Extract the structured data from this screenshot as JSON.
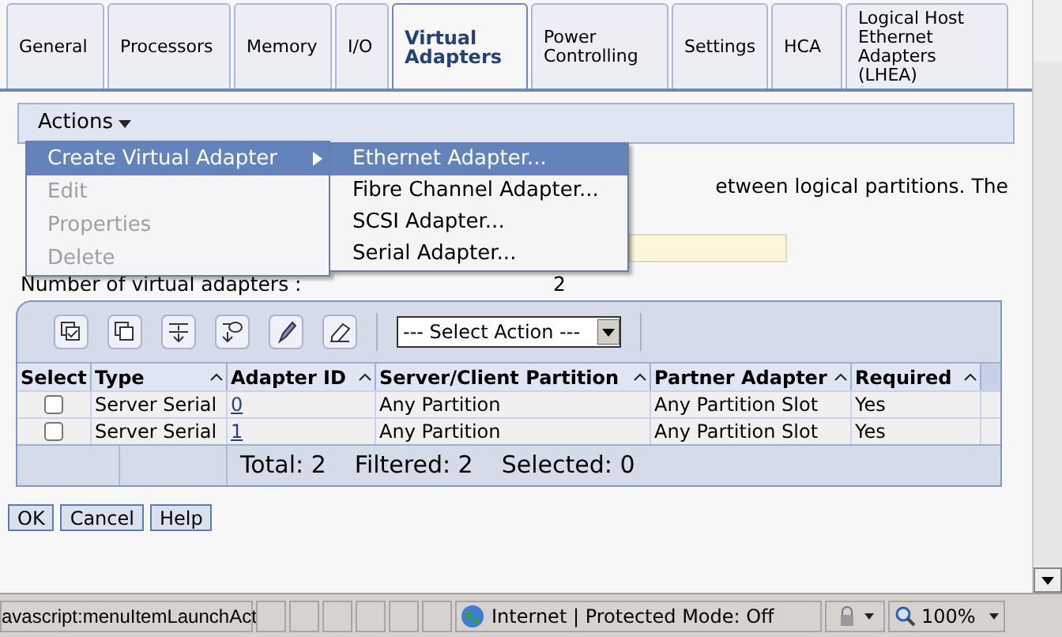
{
  "tabs": [
    {
      "label": "General",
      "selected": false
    },
    {
      "label": "Processors",
      "selected": false
    },
    {
      "label": "Memory",
      "selected": false
    },
    {
      "label": "I/O",
      "selected": false
    },
    {
      "label": "Virtual Adapters",
      "selected": true
    },
    {
      "label": "Power Controlling",
      "selected": false
    },
    {
      "label": "Settings",
      "selected": false
    },
    {
      "label": "HCA",
      "selected": false
    },
    {
      "label": "Logical Host Ethernet Adapters (LHEA)",
      "selected": false
    }
  ],
  "actions_menu": {
    "label": "Actions",
    "items": [
      {
        "label": "Create Virtual Adapter",
        "disabled": false,
        "selected": true,
        "has_submenu": true
      },
      {
        "label": "Edit",
        "disabled": true,
        "selected": false,
        "has_submenu": false
      },
      {
        "label": "Properties",
        "disabled": true,
        "selected": false,
        "has_submenu": false
      },
      {
        "label": "Delete",
        "disabled": true,
        "selected": false,
        "has_submenu": false
      }
    ],
    "submenu": [
      {
        "label": "Ethernet Adapter...",
        "selected": true
      },
      {
        "label": "Fibre Channel Adapter...",
        "selected": false
      },
      {
        "label": "SCSI Adapter...",
        "selected": false
      },
      {
        "label": "Serial Adapter...",
        "selected": false
      }
    ]
  },
  "partly_hidden_text": {
    "line_1_end": "etween logical partitions. The"
  },
  "adapter_count": {
    "label": "Number of virtual adapters :",
    "value": "2"
  },
  "table": {
    "select_action": "--- Select Action ---",
    "columns": [
      "Select",
      "Type",
      "Adapter ID",
      "Server/Client Partition",
      "Partner Adapter",
      "Required"
    ],
    "rows": [
      {
        "checked": false,
        "type": "Server Serial",
        "adapter_id": "0",
        "partition": "Any Partition",
        "partner": "Any Partition Slot",
        "required": "Yes"
      },
      {
        "checked": false,
        "type": "Server Serial",
        "adapter_id": "1",
        "partition": "Any Partition",
        "partner": "Any Partition Slot",
        "required": "Yes"
      }
    ],
    "footer": [
      "Total: 2",
      "Filtered: 2",
      "Selected: 0"
    ]
  },
  "buttons": [
    "OK",
    "Cancel",
    "Help"
  ],
  "status_bar": {
    "url": "avascript:menuItemLaunchAct",
    "zone": "Internet | Protected Mode: Off",
    "zoom": "100%"
  }
}
